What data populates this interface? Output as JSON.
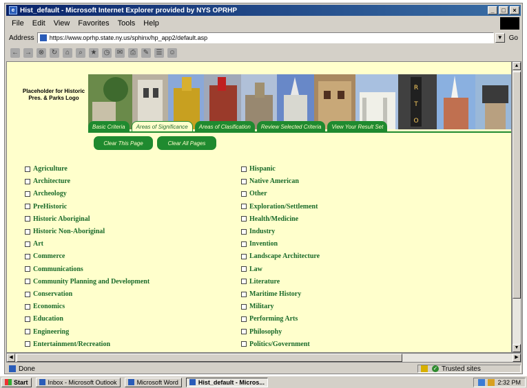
{
  "window": {
    "title": "Hist_default - Microsoft Internet Explorer provided by NYS OPRHP"
  },
  "menu": [
    "File",
    "Edit",
    "View",
    "Favorites",
    "Tools",
    "Help"
  ],
  "address": {
    "label": "Address",
    "url": "https://www.oprhp.state.ny.us/sphinx/hp_app2/default.asp",
    "go_label": "Go"
  },
  "toolbar_icons": [
    "back-icon",
    "forward-icon",
    "stop-icon",
    "refresh-icon",
    "home-icon",
    "search-icon",
    "favorites-icon",
    "history-icon",
    "mail-icon",
    "print-icon",
    "edit-icon",
    "discuss-icon",
    "messenger-icon"
  ],
  "page": {
    "logo_placeholder": "Placeholder for Historic Pres. & Parks Logo",
    "tabs": [
      {
        "label": "Basic Criteria",
        "active": false
      },
      {
        "label": "Areas of Significance",
        "active": true
      },
      {
        "label": "Areas of Clasification",
        "active": false
      },
      {
        "label": "Review Selected Criteria",
        "active": false
      },
      {
        "label": "View Your Result Set",
        "active": false
      }
    ],
    "buttons": {
      "clear_page": "Clear This Page",
      "clear_all": "Clear All Pages"
    },
    "left_column": [
      "Agriculture",
      "Architecture",
      "Archeology",
      "PreHistoric",
      "Historic Aboriginal",
      "Historic Non-Aboriginal",
      "Art",
      "Commerce",
      "Communications",
      "Community Planning and Development",
      "Conservation",
      "Economics",
      "Education",
      "Engineering",
      "Entertainment/Recreation"
    ],
    "right_column": [
      "Hispanic",
      "Native American",
      "Other",
      "Exploration/Settlement",
      "Health/Medicine",
      "Industry",
      "Invention",
      "Landscape Architecture",
      "Law",
      "Literature",
      "Maritime History",
      "Military",
      "Performing Arts",
      "Philosophy",
      "Politics/Government"
    ],
    "colors": {
      "background": "#ffffcc",
      "accent_green": "#1f8a2f",
      "label_green": "#1a6a2a"
    }
  },
  "status": {
    "text": "Done",
    "zone": "Trusted sites"
  },
  "taskbar": {
    "start": "Start",
    "tasks": [
      {
        "label": "Inbox - Microsoft Outlook",
        "active": false
      },
      {
        "label": "Microsoft Word",
        "active": false
      },
      {
        "label": "Hist_default - Micros...",
        "active": true
      }
    ],
    "clock": "2:32 PM"
  }
}
